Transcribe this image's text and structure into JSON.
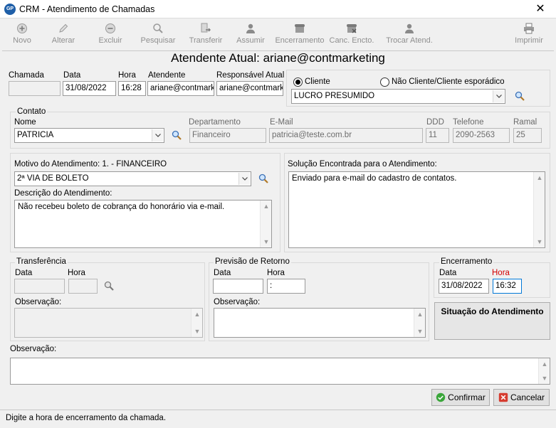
{
  "window": {
    "title": "CRM - Atendimento de Chamadas",
    "app_icon_text": "GP"
  },
  "toolbar": {
    "novo": "Novo",
    "alterar": "Alterar",
    "excluir": "Excluir",
    "pesquisar": "Pesquisar",
    "transferir": "Transferir",
    "assumir": "Assumir",
    "encerramento": "Encerramento",
    "canc_encto": "Canc. Encto.",
    "trocar_atend": "Trocar Atend.",
    "imprimir": "Imprimir"
  },
  "banner": "Atendente Atual: ariane@contmarketing",
  "chamada": {
    "chamada_label": "Chamada",
    "chamada_value": "",
    "data_label": "Data",
    "data_value": "31/08/2022",
    "hora_label": "Hora",
    "hora_value": "16:28",
    "atendente_label": "Atendente",
    "atendente_value": "ariane@contmarketing",
    "responsavel_label": "Responsável Atual",
    "responsavel_value": "ariane@contmarketing"
  },
  "cliente": {
    "radio_cliente": "Cliente",
    "radio_nao_cliente": "Não Cliente/Cliente esporádico",
    "selected": "cliente",
    "cliente_value": "LUCRO PRESUMIDO"
  },
  "contato": {
    "group_title": "Contato",
    "nome_label": "Nome",
    "nome_value": "PATRICIA",
    "departamento_label": "Departamento",
    "departamento_value": "Financeiro",
    "email_label": "E-Mail",
    "email_value": "patricia@teste.com.br",
    "ddd_label": "DDD",
    "ddd_value": "11",
    "telefone_label": "Telefone",
    "telefone_value": "2090-2563",
    "ramal_label": "Ramal",
    "ramal_value": "25"
  },
  "motivo": {
    "label": "Motivo do Atendimento: 1. - FINANCEIRO",
    "value": "2ª VIA DE BOLETO",
    "descricao_label": "Descrição do Atendimento:",
    "descricao_value": "Não recebeu boleto de cobrança do honorário via e-mail."
  },
  "solucao": {
    "label": "Solução Encontrada para o Atendimento:",
    "value": "Enviado para e-mail do cadastro de contatos."
  },
  "transferencia": {
    "group_title": "Transferência",
    "data_label": "Data",
    "data_value": "",
    "hora_label": "Hora",
    "hora_value": "",
    "obs_label": "Observação:",
    "obs_value": ""
  },
  "previsao": {
    "group_title": "Previsão de Retorno",
    "data_label": "Data",
    "data_value": "",
    "hora_label": "Hora",
    "hora_value": " :",
    "obs_label": "Observação:",
    "obs_value": ""
  },
  "encerramento": {
    "group_title": "Encerramento",
    "data_label": "Data",
    "data_value": "31/08/2022",
    "hora_label": "Hora",
    "hora_value": "16:32",
    "situacao_button": "Situação do Atendimento"
  },
  "observacao": {
    "label": "Observação:",
    "value": ""
  },
  "buttons": {
    "confirmar": "Confirmar",
    "cancelar": "Cancelar"
  },
  "status_bar": "Digite a hora de encerramento da chamada.",
  "colors": {
    "required_label": "#d40000",
    "focus_border": "#0078d7",
    "confirm_icon": "#3aa63a",
    "cancel_icon": "#d63b2f"
  }
}
